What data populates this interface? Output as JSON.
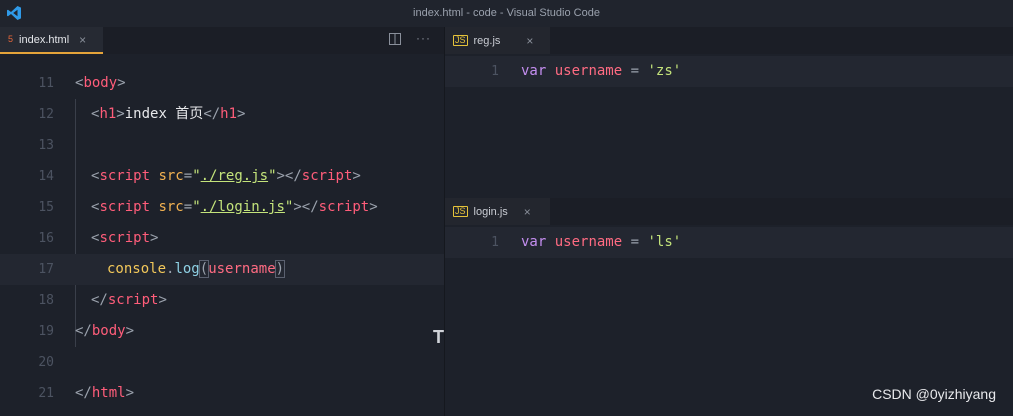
{
  "window": {
    "title": "index.html - code - Visual Studio Code"
  },
  "left_editor": {
    "tab": {
      "label": "index.html",
      "icon": "html5-icon",
      "accent": "#e5a43a"
    },
    "lines": [
      {
        "no": "11"
      },
      {
        "no": "12"
      },
      {
        "no": "13"
      },
      {
        "no": "14"
      },
      {
        "no": "15"
      },
      {
        "no": "16"
      },
      {
        "no": "17"
      },
      {
        "no": "18"
      },
      {
        "no": "19"
      },
      {
        "no": "20"
      },
      {
        "no": "21"
      }
    ],
    "h1_text": "index 首页",
    "reg_src": "./reg.js",
    "login_src": "./login.js"
  },
  "right_top": {
    "tab": {
      "label": "reg.js",
      "icon": "js-file-icon"
    },
    "line_no": "1",
    "code": {
      "kw": "var",
      "name": "username",
      "op": " = ",
      "value": "'zs'"
    }
  },
  "right_bottom": {
    "tab": {
      "label": "login.js",
      "icon": "js-file-icon"
    },
    "line_no": "1",
    "code": {
      "kw": "var",
      "name": "username",
      "op": " = ",
      "value": "'ls'"
    }
  },
  "watermark": "CSDN @0yizhiyang",
  "colors": {
    "tag": "#ff5d7a",
    "attr": "#f3b251",
    "string": "#c4e47b",
    "keyword": "#c48ef0",
    "background": "#1d212a"
  }
}
